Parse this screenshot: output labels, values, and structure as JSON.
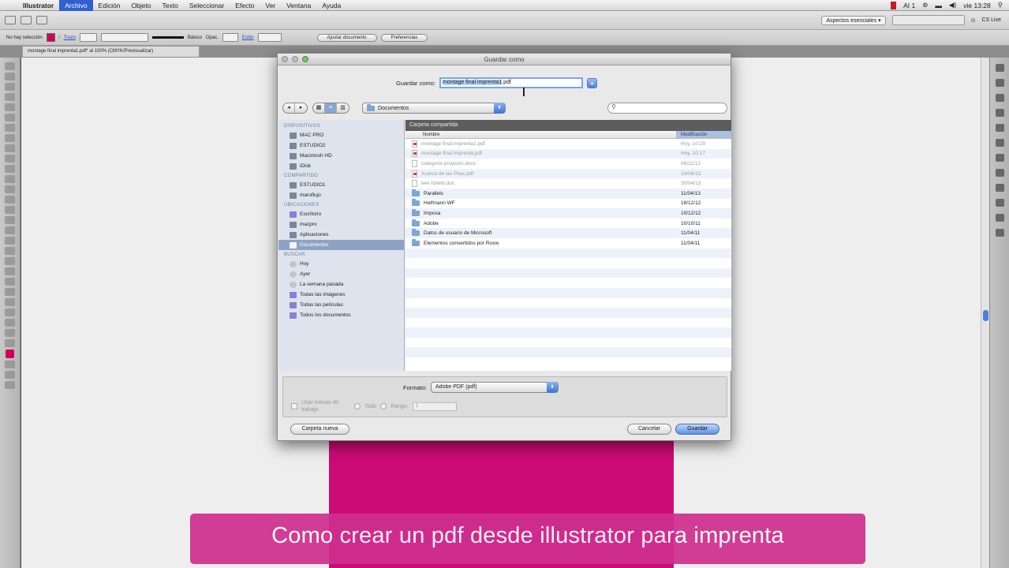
{
  "menubar": {
    "items": [
      "Illustrator",
      "Archivo",
      "Edición",
      "Objeto",
      "Texto",
      "Seleccionar",
      "Efecto",
      "Ver",
      "Ventana",
      "Ayuda"
    ],
    "active_index": 1,
    "status_text": "AI 1",
    "clock": "vie 13:28"
  },
  "appbar": {
    "workspace": "Aspectos esenciales ▾",
    "user": "CS Live"
  },
  "controlbar": {
    "selection": "No hay selección",
    "trazo": "Trazo",
    "stroke_style": "Básico",
    "opacidad_label": "Opac.",
    "estilo": "Estilo",
    "doc_button": "Ajustar documento",
    "pref_button": "Preferencias"
  },
  "doc_tab": "montage final imprenta1.pdf* al 100% (CMYK/Previsualizar)",
  "dialog": {
    "title": "Guardar como",
    "saveas_label": "Guardar como:",
    "filename_selected": "montage final imprenta1",
    "filename_ext": ".pdf",
    "location": "Documentos",
    "shared_folder": "Carpeta compartida",
    "col_name": "Nombre",
    "col_date": "Modificación",
    "sidebar": {
      "sections": [
        {
          "head": "DISPOSITIVOS",
          "items": [
            "MAC PRO",
            "ESTUDIO2",
            "Macintosh HD",
            "iDisk"
          ]
        },
        {
          "head": "COMPARTIDO",
          "items": [
            "ESTUDIO1",
            "maroflujo"
          ]
        },
        {
          "head": "UBICACIONES",
          "items": [
            "Escritorio",
            "macpro",
            "Aplicaciones",
            "Documentos"
          ]
        },
        {
          "head": "BUSCAR",
          "items": [
            "Hoy",
            "Ayer",
            "La semana pasada",
            "Todas las imágenes",
            "Todas las películas",
            "Todos los documentos"
          ]
        }
      ]
    },
    "files": [
      {
        "name": "montage final imprenta1.pdf",
        "date": "Hoy, 10:29",
        "kind": "pdf",
        "dim": true
      },
      {
        "name": "montage final imprenta.pdf",
        "date": "Hoy, 10:17",
        "kind": "pdf",
        "dim": true
      },
      {
        "name": "categoria proyecto.docx",
        "date": "06/11/13",
        "kind": "doc",
        "dim": true
      },
      {
        "name": "Acerca de las Pilas.pdf",
        "date": "14/06/13",
        "kind": "pdf",
        "dim": true
      },
      {
        "name": "leer folleto.doc",
        "date": "30/04/13",
        "kind": "doc",
        "dim": true
      },
      {
        "name": "Parallels",
        "date": "11/04/13",
        "kind": "folder",
        "dim": false
      },
      {
        "name": "Helfmann WF",
        "date": "18/12/12",
        "kind": "folder",
        "dim": false
      },
      {
        "name": "Imposa",
        "date": "10/12/12",
        "kind": "folder",
        "dim": false
      },
      {
        "name": "Adobe",
        "date": "10/10/11",
        "kind": "folder",
        "dim": false
      },
      {
        "name": "Datos de usuario de Microsoft",
        "date": "11/04/11",
        "kind": "folder",
        "dim": false
      },
      {
        "name": "Elementos convertidos por Roxio",
        "date": "11/04/11",
        "kind": "folder",
        "dim": false
      }
    ],
    "format_label": "Formato:",
    "format_value": "Adobe PDF (pdf)",
    "use_artboards": "Usar mesas de trabajo",
    "all_label": "Todo",
    "range_label": "Rango:",
    "range_value": "1",
    "new_folder": "Carpeta nueva",
    "cancel": "Cancelar",
    "save": "Guardar"
  },
  "caption": "Como crear un pdf desde illustrator para imprenta",
  "colors": {
    "artboard": "#cc0b76",
    "caption_bg": "#cf2f8e",
    "accent": "#2f5fd0"
  }
}
